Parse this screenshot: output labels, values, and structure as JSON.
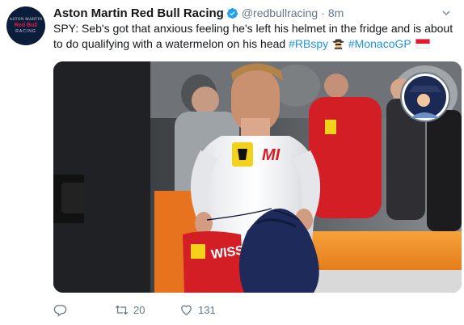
{
  "tweet": {
    "author_name": "Aston Martin Red Bull Racing",
    "handle": "@redbullracing",
    "separator": "·",
    "time": "8m",
    "text_main": "SPY: Seb's got that anxious feeling he's left his helmet in the fridge and is about to do qualifying with a watermelon on his head ",
    "hashtag1": "#RBspy",
    "hashtag2": "#MonacoGP",
    "verified": true
  },
  "avatar": {
    "line1": "ASTON MARTIN",
    "line2": "Red Bull",
    "line3": "RACING"
  },
  "photo": {
    "shirt_text": "MI",
    "bag_text": "WISS"
  },
  "actions": {
    "reply_count": "",
    "retweet_count": "20",
    "like_count": "131"
  },
  "colors": {
    "link": "#1b95e0",
    "verified": "#1da1f2",
    "secondary_text": "#657786",
    "ferrari_red": "#d41e26"
  },
  "icons": [
    "verified-badge-icon",
    "chevron-down-icon",
    "spy-emoji-icon",
    "monaco-flag-icon",
    "reply-icon",
    "retweet-icon",
    "like-icon"
  ]
}
